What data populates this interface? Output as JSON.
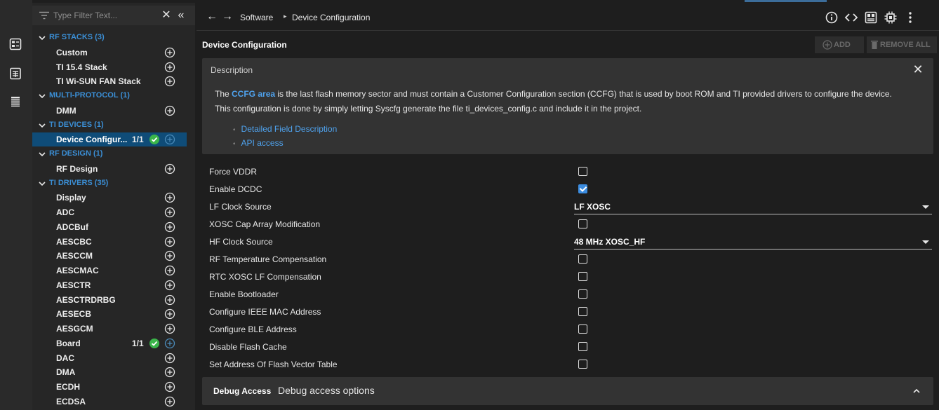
{
  "filter": {
    "placeholder": "Type Filter Text..."
  },
  "sidebar": {
    "categories": [
      {
        "label": "RF STACKS (3)",
        "items": [
          {
            "label": "Custom"
          },
          {
            "label": "TI 15.4 Stack"
          },
          {
            "label": "TI Wi-SUN FAN Stack"
          }
        ]
      },
      {
        "label": "MULTI-PROTOCOL (1)",
        "items": [
          {
            "label": "DMM"
          }
        ]
      },
      {
        "label": "TI DEVICES (1)",
        "items": [
          {
            "label": "Device Configur...",
            "count": "1/1",
            "selected": true
          }
        ]
      },
      {
        "label": "RF DESIGN (1)",
        "items": [
          {
            "label": "RF Design"
          }
        ]
      },
      {
        "label": "TI DRIVERS (35)",
        "items": [
          {
            "label": "Display"
          },
          {
            "label": "ADC"
          },
          {
            "label": "ADCBuf"
          },
          {
            "label": "AESCBC"
          },
          {
            "label": "AESCCM"
          },
          {
            "label": "AESCMAC"
          },
          {
            "label": "AESCTR"
          },
          {
            "label": "AESCTRDRBG"
          },
          {
            "label": "AESECB"
          },
          {
            "label": "AESGCM"
          },
          {
            "label": "Board",
            "count": "1/1"
          },
          {
            "label": "DAC"
          },
          {
            "label": "DMA"
          },
          {
            "label": "ECDH"
          },
          {
            "label": "ECDSA"
          }
        ]
      }
    ]
  },
  "breadcrumb": {
    "root": "Software",
    "current": "Device Configuration"
  },
  "page": {
    "title": "Device Configuration",
    "add_label": "ADD",
    "remove_all_label": "REMOVE ALL"
  },
  "description": {
    "title": "Description",
    "text_keyword": "CCFG area",
    "text_pre": "The ",
    "text_line1_rest": " is the last flash memory sector and must contain a Customer Configuration section (CCFG) that is used by boot ROM and TI provided drivers to configure the device.",
    "text_line2": "This configuration is done by simply letting Syscfg generate the file ti_devices_config.c and include it in the project.",
    "links": [
      "Detailed Field Description",
      "API access"
    ]
  },
  "config": [
    {
      "label": "Force VDDR",
      "type": "checkbox",
      "checked": false
    },
    {
      "label": "Enable DCDC",
      "type": "checkbox",
      "checked": true
    },
    {
      "label": "LF Clock Source",
      "type": "select",
      "value": "LF XOSC"
    },
    {
      "label": "XOSC Cap Array Modification",
      "type": "checkbox",
      "checked": false
    },
    {
      "label": "HF Clock Source",
      "type": "select",
      "value": "48 MHz XOSC_HF"
    },
    {
      "label": "RF Temperature Compensation",
      "type": "checkbox",
      "checked": false
    },
    {
      "label": "RTC XOSC LF Compensation",
      "type": "checkbox",
      "checked": false
    },
    {
      "label": "Enable Bootloader",
      "type": "checkbox",
      "checked": false
    },
    {
      "label": "Configure IEEE MAC Address",
      "type": "checkbox",
      "checked": false
    },
    {
      "label": "Configure BLE Address",
      "type": "checkbox",
      "checked": false
    },
    {
      "label": "Disable Flash Cache",
      "type": "checkbox",
      "checked": false
    },
    {
      "label": "Set Address Of Flash Vector Table",
      "type": "checkbox",
      "checked": false
    }
  ],
  "debug": {
    "title": "Debug Access",
    "subtitle": "Debug access options"
  },
  "colors": {
    "accent": "#3b8fd6",
    "selected": "#0f4c78",
    "ok": "#3bb54a",
    "link": "#4fa3ef"
  }
}
